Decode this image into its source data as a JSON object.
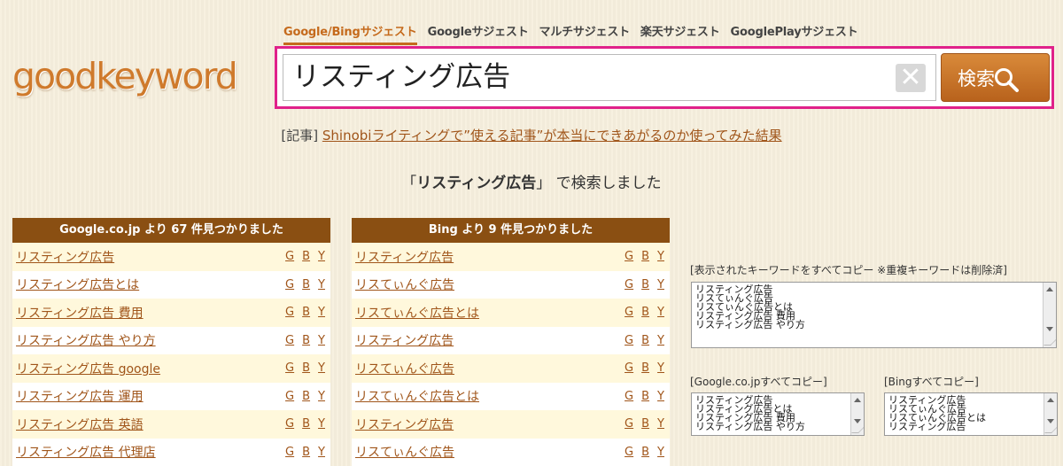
{
  "tabs": [
    "Google/Bingサジェスト",
    "Googleサジェスト",
    "マルチサジェスト",
    "楽天サジェスト",
    "GooglePlayサジェスト"
  ],
  "logo": "goodkeyword",
  "search": {
    "value": "リスティング広告",
    "clear": "✕",
    "button": "検索"
  },
  "article": {
    "prefix": "[記事]",
    "link": "Shinobiライティングで”使える記事”が本当にできあがるのか使ってみた結果"
  },
  "result_msg": {
    "open": "「",
    "keyword": "リスティング広告",
    "close": "」",
    "suffix": " で検索しました"
  },
  "google": {
    "header": "Google.co.jp より 67 件見つかりました",
    "items": [
      "リスティング広告",
      "リスティング広告とは",
      "リスティング広告 費用",
      "リスティング広告 やり方",
      "リスティング広告 google",
      "リスティング広告 運用",
      "リスティング広告 英語",
      "リスティング広告 代理店"
    ]
  },
  "bing": {
    "header": "Bing より 9 件見つかりました",
    "items": [
      "リスティング広告",
      "リスてぃんぐ広告",
      "リスてぃんぐ広告とは",
      "リスティング広告",
      "リスてぃんぐ広告",
      "リスてぃんぐ広告とは",
      "リスティング広告",
      "リスてぃんぐ広告"
    ]
  },
  "gby": [
    "G",
    "B",
    "Y"
  ],
  "copy_all": {
    "label": "[表示されたキーワードをすべてコピー ※重複キーワードは削除済]",
    "lines": [
      "リスティング広告",
      "リスてぃんぐ広告",
      "リスてぃんぐ広告とは",
      "リスティング広告 費用",
      "リスティング広告 やり方"
    ]
  },
  "copy_google": {
    "label": "[Google.co.jpすべてコピー]",
    "lines": [
      "リスティング広告",
      "リスティング広告とは",
      "リスティング広告 費用",
      "リスティング広告 やり方"
    ]
  },
  "copy_bing": {
    "label": "[Bingすべてコピー]",
    "lines": [
      "リスティング広告",
      "リスてぃんぐ広告",
      "リスてぃんぐ広告とは",
      "リスティング広告"
    ]
  },
  "colors": {
    "accent": "#c56a1c",
    "highlight_border": "#e0218a",
    "panel_header": "#8a4f12"
  }
}
